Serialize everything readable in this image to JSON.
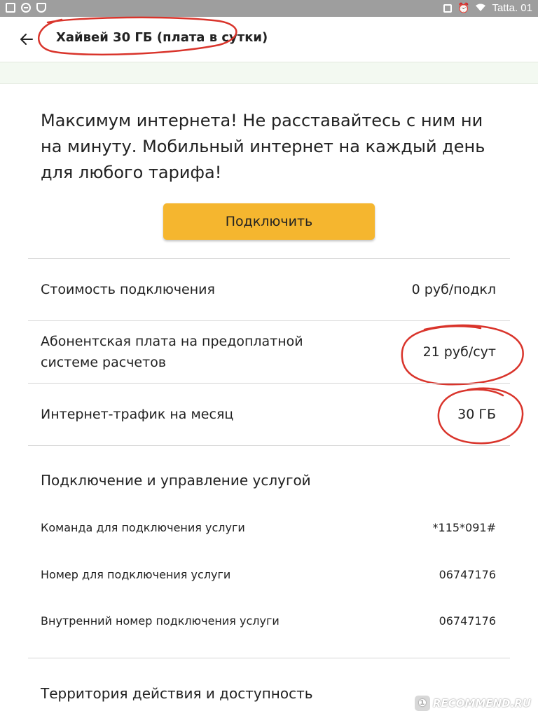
{
  "status_bar": {
    "time": "Tatta. 01",
    "colors": {
      "background": "#9e9e9e",
      "foreground": "#ffffff"
    }
  },
  "header": {
    "back_icon": "arrow-left-icon",
    "title": "Хайвей 30 ГБ (плата в сутки)"
  },
  "intro": {
    "text": "Максимум интернета! Не расставайтесь с ним ни на минуту. Мобильный интернет на каждый день для любого тарифа!"
  },
  "connect_button": {
    "label": "Подключить",
    "color": "#f5b62f"
  },
  "params": [
    {
      "label": "Стоимость подключения",
      "value": "0 руб/подкл"
    },
    {
      "label": "Абонентская плата на предоплатной системе расчетов",
      "value": "21 руб/сут"
    },
    {
      "label": "Интернет-трафик на месяц",
      "value": "30 ГБ"
    }
  ],
  "management": {
    "title": "Подключение и управление услугой",
    "items": [
      {
        "label": "Команда для подключения услуги",
        "value": "*115*091#"
      },
      {
        "label": "Номер для подключения услуги",
        "value": "06747176"
      },
      {
        "label": "Внутренний номер подключения услуги",
        "value": "06747176"
      }
    ]
  },
  "territory": {
    "title": "Территория действия и доступность"
  },
  "watermark": {
    "text": "RECOMMEND.RU"
  },
  "annotation_color": "#d9342b"
}
